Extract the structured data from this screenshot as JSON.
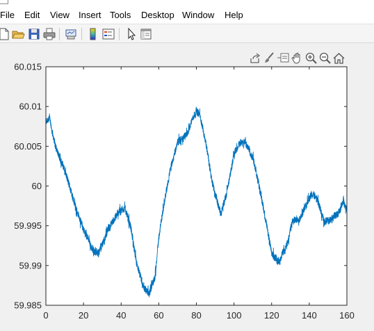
{
  "menu": {
    "items": [
      "File",
      "Edit",
      "View",
      "Insert",
      "Tools",
      "Desktop",
      "Window",
      "Help"
    ]
  },
  "toolbar": {
    "icons": [
      "new-file-icon",
      "open-folder-icon",
      "save-icon",
      "print-icon",
      "link-plot-icon",
      "insert-colorbar-icon",
      "insert-legend-icon",
      "edit-plot-icon",
      "property-inspector-icon"
    ]
  },
  "axes_toolbar": {
    "icons": [
      "export-icon",
      "brush-icon",
      "data-tips-icon",
      "pan-icon",
      "zoom-in-icon",
      "zoom-out-icon",
      "home-icon"
    ]
  },
  "colors": {
    "line": "#0072bd",
    "axes_background": "#ffffff",
    "figure_background": "#f0f0f0",
    "axis_color": "#262626"
  },
  "chart_data": {
    "type": "line",
    "title": "",
    "xlabel": "",
    "ylabel": "",
    "xlim": [
      0,
      160
    ],
    "ylim": [
      59.985,
      60.015
    ],
    "xticks": [
      "0",
      "20",
      "40",
      "60",
      "80",
      "100",
      "120",
      "140",
      "160"
    ],
    "yticks": [
      "59.985",
      "59.99",
      "59.995",
      "60",
      "60.005",
      "60.01",
      "60.015"
    ],
    "grid": false,
    "noise_amplitude": 0.0007,
    "series": [
      {
        "color": "#0072bd",
        "x": [
          0,
          2,
          5,
          10,
          15,
          20,
          25,
          28,
          33,
          38,
          40,
          42,
          45,
          48,
          52,
          55,
          58,
          60,
          63,
          66,
          70,
          72,
          75,
          78,
          80,
          82,
          85,
          88,
          90,
          93,
          96,
          100,
          103,
          106,
          110,
          113,
          117,
          120,
          124,
          128,
          131,
          135,
          139,
          141,
          144,
          148,
          152,
          156,
          158,
          160
        ],
        "y": [
          60.008,
          60.0085,
          60.005,
          60.002,
          59.998,
          59.9945,
          59.992,
          59.9915,
          59.9945,
          59.9965,
          59.997,
          59.9972,
          59.995,
          59.9905,
          59.987,
          59.9865,
          59.9885,
          59.9935,
          59.998,
          60.002,
          60.0055,
          60.0058,
          60.0065,
          60.0085,
          60.0095,
          60.0088,
          60.0055,
          60.001,
          59.999,
          59.9965,
          59.999,
          60.004,
          60.0055,
          60.0055,
          60.0035,
          60.0005,
          59.9955,
          59.9915,
          59.9905,
          59.9925,
          59.9955,
          59.996,
          59.998,
          59.999,
          59.9985,
          59.9955,
          59.9958,
          59.9968,
          59.998,
          59.997
        ]
      }
    ]
  }
}
